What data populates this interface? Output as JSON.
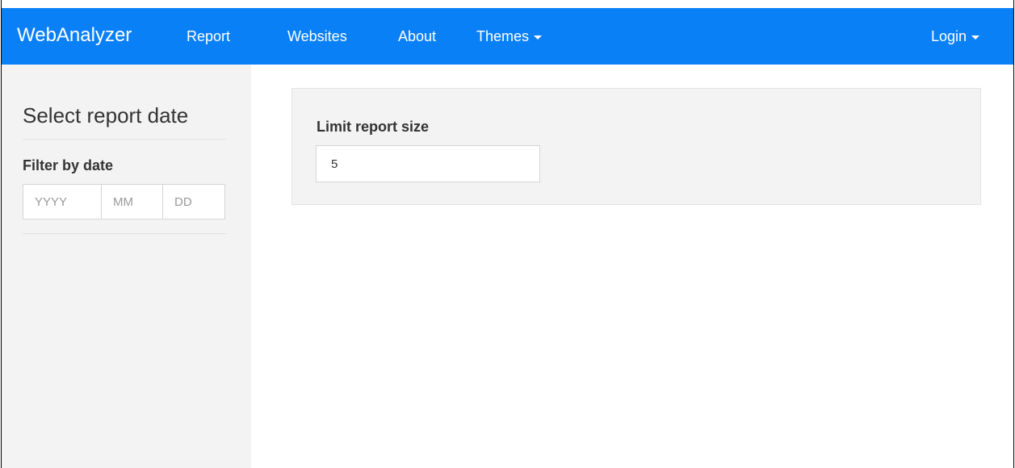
{
  "navbar": {
    "brand": "WebAnalyzer",
    "items": [
      {
        "label": "Report"
      },
      {
        "label": "Websites"
      },
      {
        "label": "About"
      },
      {
        "label": "Themes"
      }
    ],
    "login": "Login",
    "color": "#0a80f7"
  },
  "sidebar": {
    "title": "Select report date",
    "filter_label": "Filter by date",
    "date": {
      "year_placeholder": "YYYY",
      "month_placeholder": "MM",
      "day_placeholder": "DD"
    }
  },
  "main": {
    "limit_label": "Limit report size",
    "limit_value": "5"
  }
}
